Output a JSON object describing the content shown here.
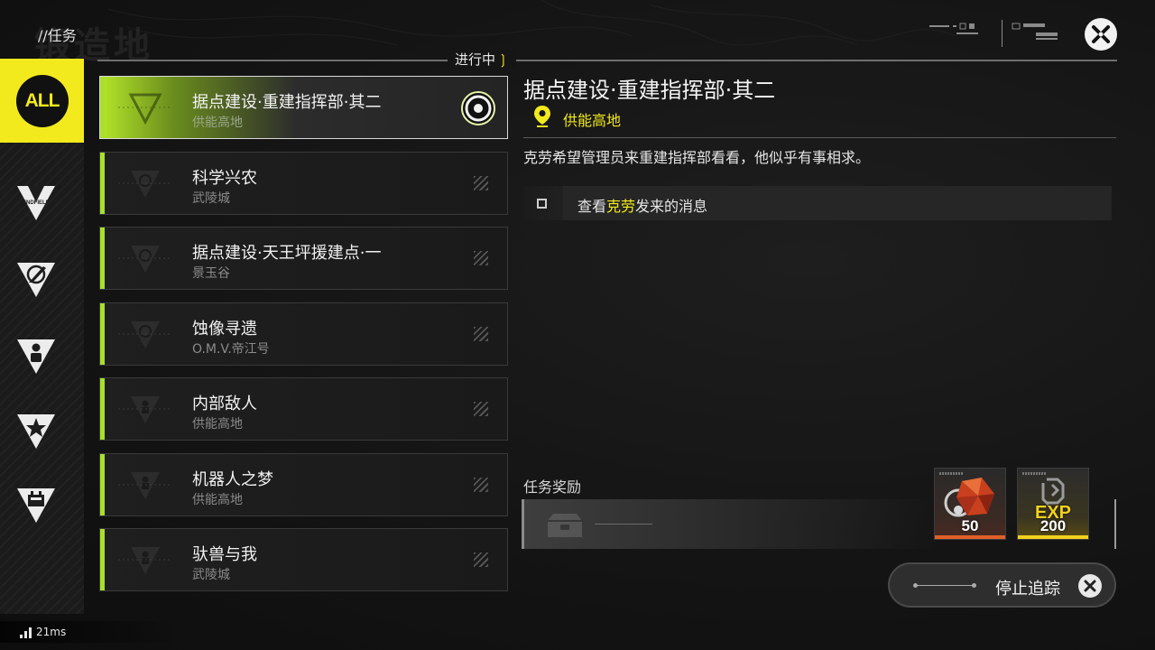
{
  "header": {
    "breadcrumb": "//任务",
    "watermark": "锻造地",
    "in_progress_label": "进行中"
  },
  "sidebar": {
    "items": [
      {
        "label": "ALL",
        "icon": "all-badge",
        "selected": true
      },
      {
        "label": "ENDFIELD",
        "icon": "endfield-icon",
        "selected": false
      },
      {
        "icon": "blade-icon",
        "selected": false
      },
      {
        "icon": "person-icon",
        "selected": false
      },
      {
        "icon": "star-icon",
        "selected": false
      },
      {
        "icon": "battery-icon",
        "selected": false
      }
    ]
  },
  "quests": [
    {
      "title": "据点建设·重建指挥部·其二",
      "location": "供能高地",
      "icon": "blade-icon",
      "selected": true,
      "tracked": true
    },
    {
      "title": "科学兴农",
      "location": "武陵城",
      "icon": "blade-icon",
      "selected": false
    },
    {
      "title": "据点建设·天王坪援建点·一",
      "location": "景玉谷",
      "icon": "blade-icon",
      "selected": false
    },
    {
      "title": "蚀像寻遗",
      "location": "O.M.V.帝江号",
      "icon": "blade-icon",
      "selected": false
    },
    {
      "title": "内部敌人",
      "location": "供能高地",
      "icon": "person-icon",
      "selected": false
    },
    {
      "title": "机器人之梦",
      "location": "供能高地",
      "icon": "person-icon",
      "selected": false
    },
    {
      "title": "驮兽与我",
      "location": "武陵城",
      "icon": "person-icon",
      "selected": false
    }
  ],
  "detail": {
    "title": "据点建设·重建指挥部·其二",
    "location": "供能高地",
    "description": "克劳希望管理员来重建指挥部看看，他似乎有事相求。",
    "objective": {
      "prefix": "查看",
      "highlight": "克劳",
      "suffix": "发来的消息",
      "completed": false
    }
  },
  "rewards": {
    "label": "任务奖励",
    "items": [
      {
        "name": "crystal-reward",
        "icon": "red-crystal-icon",
        "quantity": "50",
        "rarity_color": "#e0602a"
      },
      {
        "name": "exp-reward",
        "icon": "exp-icon",
        "label": "EXP",
        "quantity": "200",
        "rarity_color": "#f2d21c"
      }
    ]
  },
  "actions": {
    "stop_tracking": "停止追踪"
  },
  "status": {
    "ping": "21ms"
  },
  "colors": {
    "accent_yellow": "#f2ea1c",
    "accent_green": "#a8e02a",
    "background": "#141414"
  }
}
